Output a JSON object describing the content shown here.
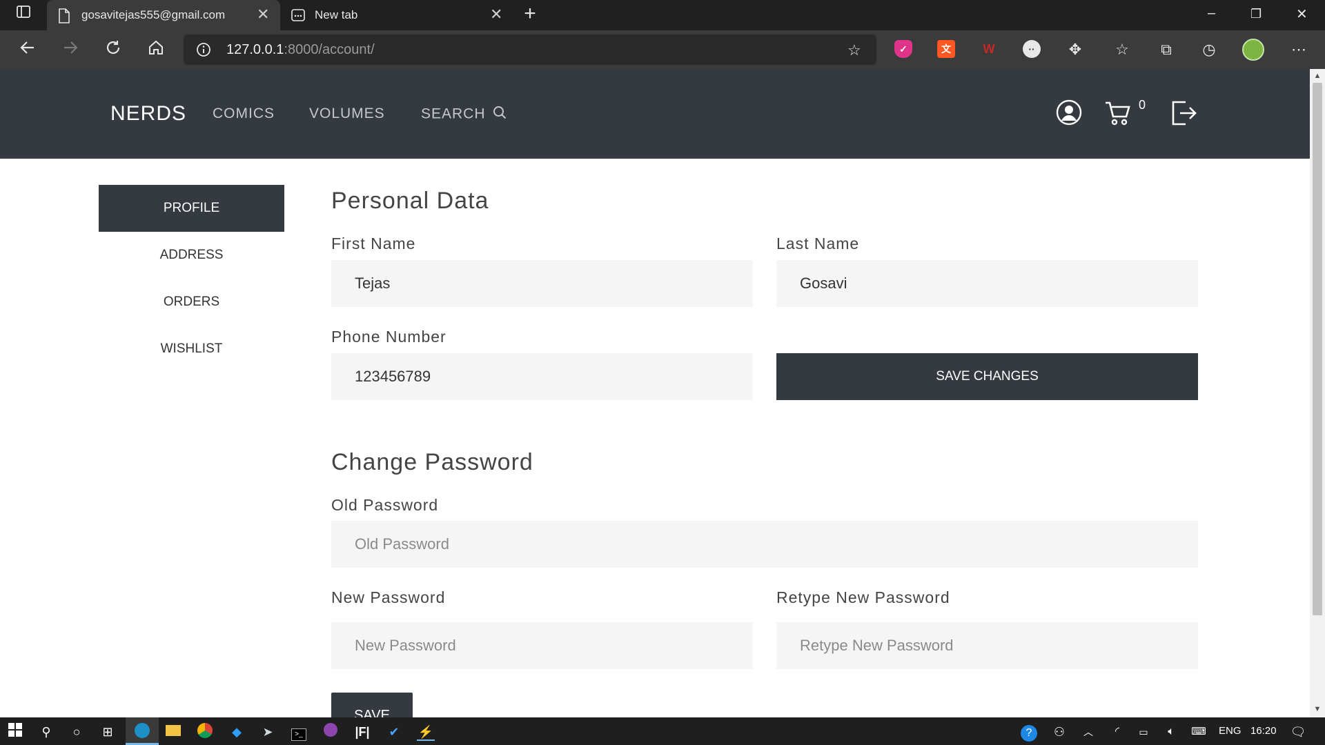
{
  "browser": {
    "tabs": [
      {
        "title": "gosavitejas555@gmail.com",
        "active": true
      },
      {
        "title": "New tab",
        "active": false
      }
    ],
    "url_host": "127.0.0.1",
    "url_rest": ":8000/account/"
  },
  "site": {
    "brand": "NERDS",
    "nav": [
      "COMICS",
      "VOLUMES",
      "SEARCH"
    ],
    "cart_count": "0"
  },
  "sidebar": {
    "items": [
      "PROFILE",
      "ADDRESS",
      "ORDERS",
      "WISHLIST"
    ],
    "active": "PROFILE"
  },
  "personal": {
    "title": "Personal Data",
    "first_name_label": "First Name",
    "first_name_value": "Tejas",
    "last_name_label": "Last Name",
    "last_name_value": "Gosavi",
    "phone_label": "Phone Number",
    "phone_value": "123456789",
    "save_label": "SAVE CHANGES"
  },
  "password": {
    "title": "Change Password",
    "old_label": "Old Password",
    "old_placeholder": "Old Password",
    "new_label": "New Password",
    "new_placeholder": "New Password",
    "retype_label": "Retype New Password",
    "retype_placeholder": "Retype New Password",
    "save_label": "SAVE"
  },
  "taskbar": {
    "lang": "ENG",
    "time": "16:20"
  },
  "colors": {
    "nav_bg": "#343a40",
    "field_bg": "#f5f5f6",
    "browser_chrome": "#3b3b3b"
  }
}
